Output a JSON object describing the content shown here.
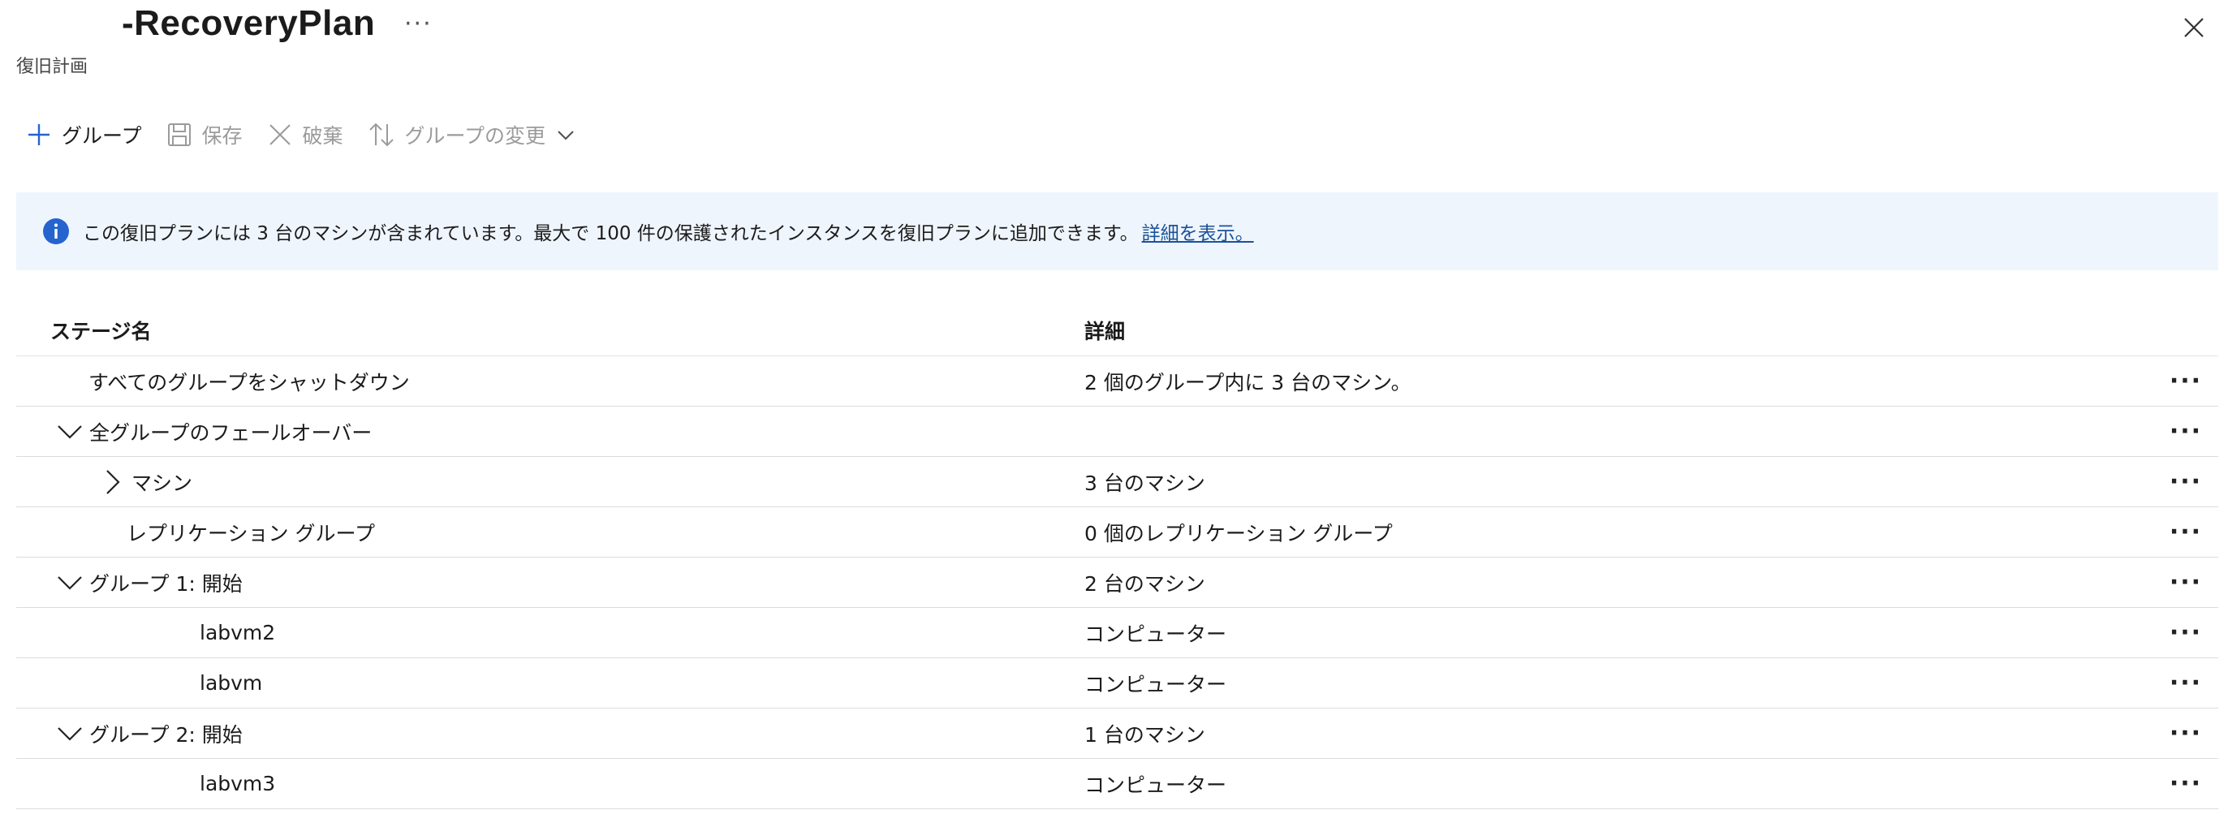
{
  "header": {
    "title": "-RecoveryPlan",
    "more": "···",
    "subtitle": "復旧計画"
  },
  "toolbar": {
    "add_group": "グループ",
    "save": "保存",
    "discard": "破棄",
    "change_group": "グループの変更"
  },
  "banner": {
    "text": "この復旧プランには 3 台のマシンが含まれています。最大で 100 件の保護されたインスタンスを復旧プランに追加できます。",
    "link": "詳細を表示。"
  },
  "table": {
    "headers": {
      "name": "ステージ名",
      "detail": "詳細"
    },
    "rows": [
      {
        "name": "すべてのグループをシャットダウン",
        "detail": "2 個のグループ内に 3 台のマシン。",
        "indent": 1,
        "chevron": "none"
      },
      {
        "name": "全グループのフェールオーバー",
        "detail": "",
        "indent": 0,
        "chevron": "down"
      },
      {
        "name": "マシン",
        "detail": "3 台のマシン",
        "indent": 1,
        "chevron": "right"
      },
      {
        "name": "レプリケーション グループ",
        "detail": "0 個のレプリケーション グループ",
        "indent": 2,
        "chevron": "none"
      },
      {
        "name": "グループ 1: 開始",
        "detail": "2 台のマシン",
        "indent": 0,
        "chevron": "down"
      },
      {
        "name": "labvm2",
        "detail": "コンピューター",
        "indent": 4,
        "chevron": "none"
      },
      {
        "name": "labvm",
        "detail": "コンピューター",
        "indent": 4,
        "chevron": "none"
      },
      {
        "name": "グループ 2: 開始",
        "detail": "1 台のマシン",
        "indent": 0,
        "chevron": "down"
      },
      {
        "name": "labvm3",
        "detail": "コンピューター",
        "indent": 4,
        "chevron": "none"
      }
    ],
    "row_more": "···"
  },
  "colors": {
    "accent": "#2564cf",
    "banner_bg": "#eff5fc",
    "link": "#1a5299",
    "disabled": "#9b9b9b"
  }
}
